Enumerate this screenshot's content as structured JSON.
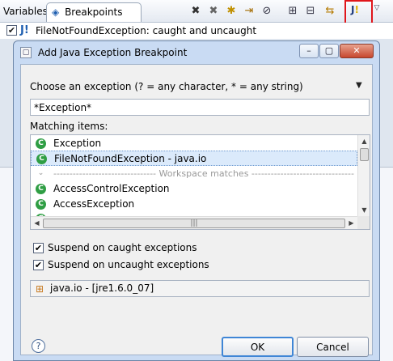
{
  "view": {
    "tabs": [
      {
        "label": "Variables"
      },
      {
        "label": "Breakpoints"
      }
    ],
    "breakpoint_row": {
      "label": "FileNotFoundException: caught and uncaught",
      "checked": true
    }
  },
  "dialog": {
    "title": "Add Java Exception Breakpoint",
    "choose_label": "Choose an exception (? = any character, * = any string)",
    "filter_value": "*Exception*",
    "matching_label": "Matching items:",
    "items": [
      {
        "label": "Exception",
        "icon": "class-icon"
      },
      {
        "label": "FileNotFoundException - java.io",
        "icon": "class-icon",
        "selected": true
      },
      {
        "label": "-------------------------------- Workspace matches --------------------------------",
        "separator": true
      },
      {
        "label": "AccessControlException",
        "icon": "class-icon"
      },
      {
        "label": "AccessException",
        "icon": "class-icon"
      }
    ],
    "suspend_caught": {
      "label": "Suspend on caught exceptions",
      "checked": true
    },
    "suspend_uncaught": {
      "label": "Suspend on uncaught exceptions",
      "checked": true
    },
    "package_status": "java.io - [jre1.6.0_07]",
    "ok_label": "OK",
    "cancel_label": "Cancel"
  },
  "colors": {
    "class_icon": "#2f9e44",
    "highlight": "#e0161b",
    "titlebar": "#c9dbf3"
  }
}
